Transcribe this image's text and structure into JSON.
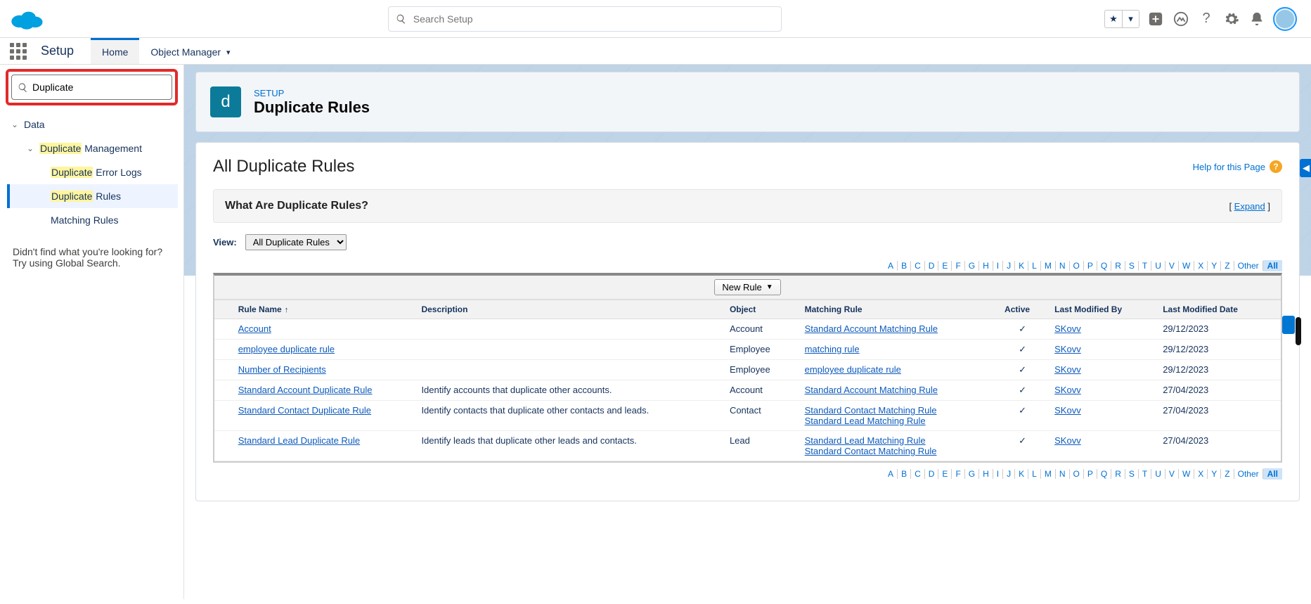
{
  "globalSearch": {
    "placeholder": "Search Setup"
  },
  "subheader": {
    "title": "Setup",
    "tabs": {
      "home": "Home",
      "objmgr": "Object Manager"
    }
  },
  "sidebar": {
    "search_value": "Duplicate",
    "tree": {
      "data": "Data",
      "dup_mgmt_pre": "Duplicate",
      "dup_mgmt_post": " Management",
      "err_pre": "Duplicate",
      "err_post": " Error Logs",
      "rules_pre": "Duplicate",
      "rules_post": " Rules",
      "matching": "Matching Rules"
    },
    "footer1": "Didn't find what you're looking for?",
    "footer2": "Try using Global Search."
  },
  "page": {
    "eyebrow": "SETUP",
    "title": "Duplicate Rules"
  },
  "content": {
    "heading": "All Duplicate Rules",
    "help": "Help for this Page",
    "whatare": "What Are Duplicate Rules?",
    "expand": "Expand",
    "view_label": "View:",
    "view_option": "All Duplicate Rules",
    "new_rule": "New Rule",
    "other": "Other",
    "all": "All",
    "alphabet": [
      "A",
      "B",
      "C",
      "D",
      "E",
      "F",
      "G",
      "H",
      "I",
      "J",
      "K",
      "L",
      "M",
      "N",
      "O",
      "P",
      "Q",
      "R",
      "S",
      "T",
      "U",
      "V",
      "W",
      "X",
      "Y",
      "Z"
    ],
    "columns": {
      "rule_name": "Rule Name",
      "description": "Description",
      "object": "Object",
      "matching_rule": "Matching Rule",
      "active": "Active",
      "modified_by": "Last Modified By",
      "modified_date": "Last Modified Date"
    },
    "rows": [
      {
        "name": "Account",
        "desc": "",
        "object": "Account",
        "matching": [
          "Standard Account Matching Rule"
        ],
        "active": true,
        "by": "SKovv",
        "date": "29/12/2023"
      },
      {
        "name": "employee duplicate rule",
        "desc": "",
        "object": "Employee",
        "matching": [
          "matching rule"
        ],
        "active": true,
        "by": "SKovv",
        "date": "29/12/2023"
      },
      {
        "name": "Number of Recipients",
        "desc": "",
        "object": "Employee",
        "matching": [
          "employee duplicate rule"
        ],
        "active": true,
        "by": "SKovv",
        "date": "29/12/2023"
      },
      {
        "name": "Standard Account Duplicate Rule",
        "desc": "Identify accounts that duplicate other accounts.",
        "object": "Account",
        "matching": [
          "Standard Account Matching Rule"
        ],
        "active": true,
        "by": "SKovv",
        "date": "27/04/2023"
      },
      {
        "name": "Standard Contact Duplicate Rule",
        "desc": "Identify contacts that duplicate other contacts and leads.",
        "object": "Contact",
        "matching": [
          "Standard Contact Matching Rule",
          "Standard Lead Matching Rule"
        ],
        "active": true,
        "by": "SKovv",
        "date": "27/04/2023"
      },
      {
        "name": "Standard Lead Duplicate Rule",
        "desc": "Identify leads that duplicate other leads and contacts.",
        "object": "Lead",
        "matching": [
          "Standard Lead Matching Rule",
          "Standard Contact Matching Rule"
        ],
        "active": true,
        "by": "SKovv",
        "date": "27/04/2023"
      }
    ]
  }
}
